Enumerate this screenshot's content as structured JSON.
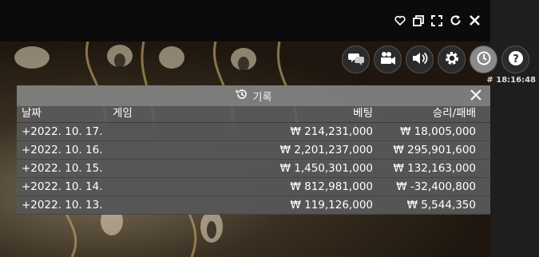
{
  "window": {
    "controls": [
      "heart-icon",
      "restore-icon",
      "fullscreen-icon",
      "refresh-icon",
      "close-icon"
    ]
  },
  "toolbar": {
    "buttons": [
      "chat-icon",
      "camera-icon",
      "volume-icon",
      "settings-icon",
      "history-icon",
      "help-icon"
    ],
    "active": "history-icon",
    "clock": "# 18:16:48"
  },
  "history": {
    "title": "기록",
    "columns": {
      "date": "날짜",
      "game": "게임",
      "bet": "베팅",
      "winloss": "승리/패배"
    },
    "rows": [
      {
        "date": "+2022. 10. 17.",
        "game": "",
        "bet": "₩ 214,231,000",
        "winloss": "₩ 18,005,000"
      },
      {
        "date": "+2022. 10. 16.",
        "game": "",
        "bet": "₩ 2,201,237,000",
        "winloss": "₩ 295,901,600"
      },
      {
        "date": "+2022. 10. 15.",
        "game": "",
        "bet": "₩ 1,450,301,000",
        "winloss": "₩ 132,163,000"
      },
      {
        "date": "+2022. 10. 14.",
        "game": "",
        "bet": "₩ 812,981,000",
        "winloss": "₩ -32,400,800"
      },
      {
        "date": "+2022. 10. 13.",
        "game": "",
        "bet": "₩ 119,126,000",
        "winloss": "₩ 5,544,350"
      }
    ]
  }
}
